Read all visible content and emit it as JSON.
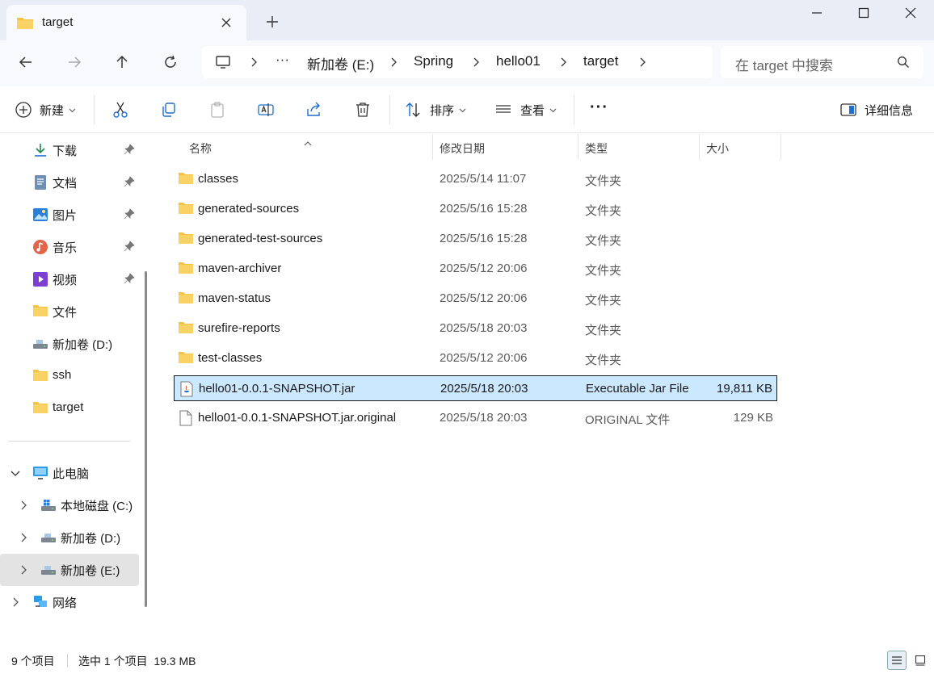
{
  "window": {
    "tab_title": "target",
    "new_tab_symbol": "+"
  },
  "address_bar": {
    "crumbs": [
      "新加卷 (E:)",
      "Spring",
      "hello01",
      "target"
    ],
    "overflow": "···",
    "search_placeholder": "在 target 中搜索"
  },
  "toolbar": {
    "new_label": "新建",
    "sort_label": "排序",
    "view_label": "查看",
    "more_label": "···",
    "details_label": "详细信息"
  },
  "sidebar": {
    "quick_access": [
      {
        "label": "下载",
        "icon": "download-icon",
        "pinned": true
      },
      {
        "label": "文档",
        "icon": "document-icon",
        "pinned": true
      },
      {
        "label": "图片",
        "icon": "pictures-icon",
        "pinned": true
      },
      {
        "label": "音乐",
        "icon": "music-icon",
        "pinned": true
      },
      {
        "label": "视频",
        "icon": "video-icon",
        "pinned": true
      },
      {
        "label": "文件",
        "icon": "folder-icon",
        "pinned": false
      },
      {
        "label": "新加卷 (D:)",
        "icon": "drive-icon",
        "pinned": false
      },
      {
        "label": "ssh",
        "icon": "folder-icon",
        "pinned": false
      },
      {
        "label": "target",
        "icon": "folder-icon",
        "pinned": false
      }
    ],
    "this_pc": "此电脑",
    "drives": [
      "本地磁盘 (C:)",
      "新加卷 (D:)",
      "新加卷 (E:)"
    ],
    "network": "网络",
    "selected_drive": "新加卷 (E:)"
  },
  "file_list": {
    "columns": [
      "名称",
      "修改日期",
      "类型",
      "大小"
    ],
    "rows": [
      {
        "name": "classes",
        "date": "2025/5/14 11:07",
        "type": "文件夹",
        "size": "",
        "icon": "folder-icon"
      },
      {
        "name": "generated-sources",
        "date": "2025/5/16 15:28",
        "type": "文件夹",
        "size": "",
        "icon": "folder-icon"
      },
      {
        "name": "generated-test-sources",
        "date": "2025/5/16 15:28",
        "type": "文件夹",
        "size": "",
        "icon": "folder-icon"
      },
      {
        "name": "maven-archiver",
        "date": "2025/5/12 20:06",
        "type": "文件夹",
        "size": "",
        "icon": "folder-icon"
      },
      {
        "name": "maven-status",
        "date": "2025/5/12 20:06",
        "type": "文件夹",
        "size": "",
        "icon": "folder-icon"
      },
      {
        "name": "surefire-reports",
        "date": "2025/5/18 20:03",
        "type": "文件夹",
        "size": "",
        "icon": "folder-icon"
      },
      {
        "name": "test-classes",
        "date": "2025/5/12 20:06",
        "type": "文件夹",
        "size": "",
        "icon": "folder-icon"
      },
      {
        "name": "hello01-0.0.1-SNAPSHOT.jar",
        "date": "2025/5/18 20:03",
        "type": "Executable Jar File",
        "size": "19,811 KB",
        "icon": "jar-file-icon",
        "selected": true
      },
      {
        "name": "hello01-0.0.1-SNAPSHOT.jar.original",
        "date": "2025/5/18 20:03",
        "type": "ORIGINAL 文件",
        "size": "129 KB",
        "icon": "file-icon"
      }
    ]
  },
  "status_bar": {
    "item_count": "9 个项目",
    "selection": "选中 1 个项目  19.3 MB"
  },
  "colors": {
    "folder": "#f5c242",
    "selection": "#cce8ff",
    "titlebar": "#e9eef6"
  }
}
